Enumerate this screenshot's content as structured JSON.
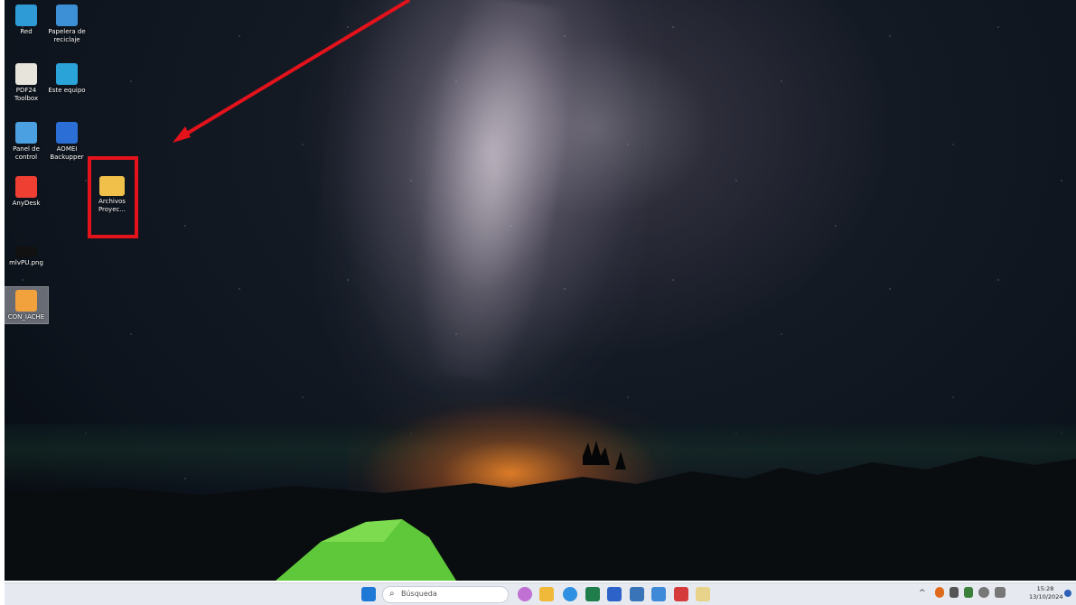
{
  "desktop": {
    "icons": [
      {
        "label": "Red"
      },
      {
        "label": "Papelera de reciclaje"
      },
      {
        "label": "PDF24 Toolbox"
      },
      {
        "label": "Este equipo"
      },
      {
        "label": "Panel de control"
      },
      {
        "label": "AOMEI Backupper"
      },
      {
        "label": "AnyDesk"
      },
      {
        "label": "Archivos Proyec..."
      },
      {
        "label": "mlvPU.png"
      },
      {
        "label": "CON_IACHE"
      }
    ]
  },
  "taskbar": {
    "search_placeholder": "Búsqueda",
    "clock_time": "15:28",
    "clock_date": "13/10/2024"
  },
  "colors": {
    "annotation_red": "#e3121b",
    "folder_yellow": "#f1c04a",
    "tent_green": "#6dd63a"
  }
}
